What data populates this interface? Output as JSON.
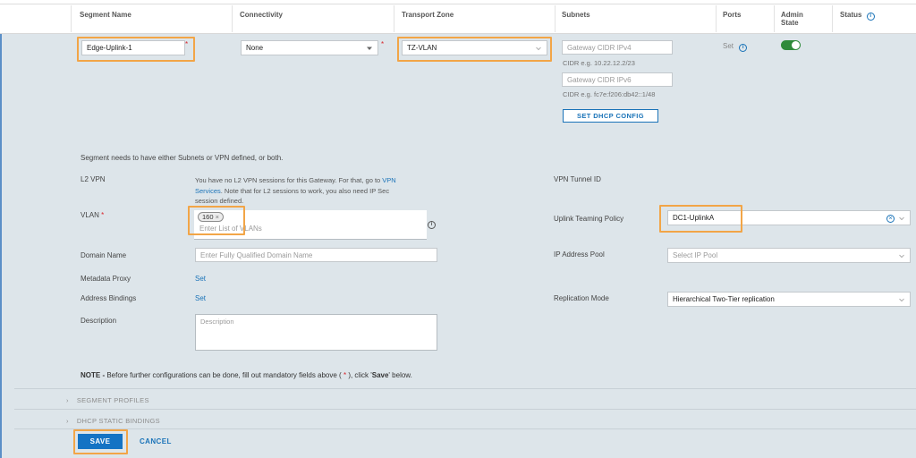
{
  "table_header": {
    "segment_name": "Segment Name",
    "connectivity": "Connectivity",
    "transport_zone": "Transport Zone",
    "subnets": "Subnets",
    "ports": "Ports",
    "admin_state_line1": "Admin",
    "admin_state_line2": "State",
    "status": "Status"
  },
  "row": {
    "segment_name_value": "Edge-Uplink-1",
    "connectivity_value": "None",
    "transport_zone_value": "TZ-VLAN",
    "gateway_ipv4_placeholder": "Gateway CIDR IPv4",
    "gateway_ipv4_hint": "CIDR e.g. 10.22.12.2/23",
    "gateway_ipv6_placeholder": "Gateway CIDR IPv6",
    "gateway_ipv6_hint": "CIDR e.g. fc7e:f206:db42::1/48",
    "dhcp_button": "SET DHCP CONFIG",
    "ports_value": "Set",
    "admin_state_on": true
  },
  "form": {
    "segment_note": "Segment needs to have either Subnets or VPN defined, or both.",
    "l2vpn_label": "L2 VPN",
    "l2vpn_text_1": "You have no L2 VPN sessions for this Gateway. For that, go to",
    "l2vpn_link_1": "VPN",
    "l2vpn_link_2": "Services",
    "l2vpn_text_2": ". Note that for L2 sessions to work, you also need IP Sec",
    "l2vpn_text_3": "session defined.",
    "vpn_tunnel_label": "VPN Tunnel ID",
    "vlan_label": "VLAN",
    "vlan_tag": "160",
    "vlan_placeholder": "Enter List of VLANs",
    "uplink_teaming_label": "Uplink Teaming Policy",
    "uplink_teaming_value": "DC1-UplinkA",
    "domain_name_label": "Domain Name",
    "domain_name_placeholder": "Enter Fully Qualified Domain Name",
    "ip_pool_label": "IP Address Pool",
    "ip_pool_placeholder": "Select IP Pool",
    "metadata_proxy_label": "Metadata Proxy",
    "metadata_proxy_value": "Set",
    "address_bindings_label": "Address Bindings",
    "address_bindings_value": "Set",
    "replication_mode_label": "Replication Mode",
    "replication_mode_value": "Hierarchical Two-Tier replication",
    "description_label": "Description",
    "description_placeholder": "Description",
    "note_bold": "NOTE -",
    "note_text_1": "Before further configurations can be done, fill out mandatory fields above (",
    "note_star": "*",
    "note_text_2": "), click '",
    "note_save": "Save",
    "note_text_3": "' below."
  },
  "sections": {
    "segment_profiles": "SEGMENT PROFILES",
    "dhcp_static_bindings": "DHCP STATIC BINDINGS"
  },
  "actions": {
    "save": "SAVE",
    "cancel": "CANCEL"
  },
  "colors": {
    "accent": "#1a73b8",
    "highlight": "#f2a547",
    "toggle_on": "#2f8a3a",
    "panel_bg": "#dde5ea",
    "required": "#d9262c"
  }
}
